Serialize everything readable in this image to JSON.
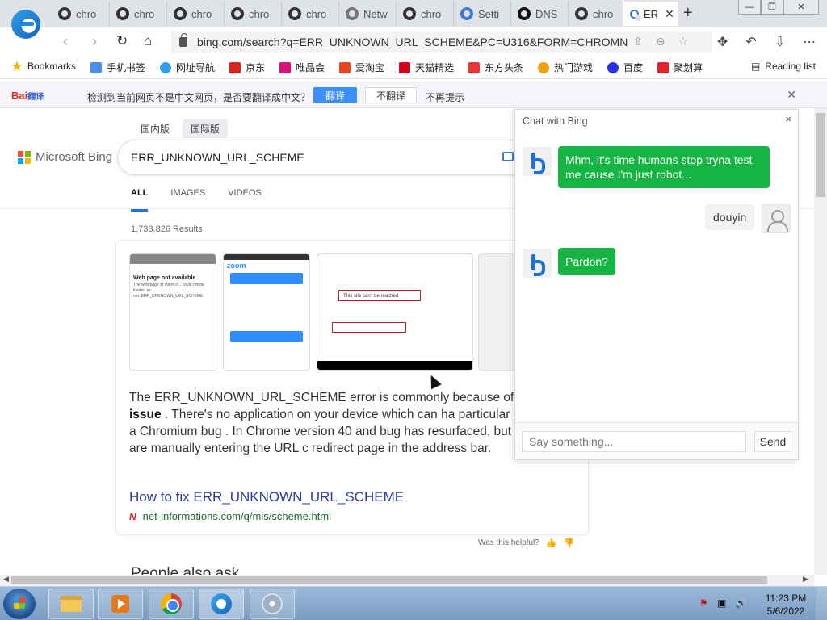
{
  "browser": {
    "tabs": [
      {
        "label": "chro",
        "icon": "chromium-icon"
      },
      {
        "label": "chro",
        "icon": "chromium-icon"
      },
      {
        "label": "chro",
        "icon": "chromium-icon"
      },
      {
        "label": "chro",
        "icon": "chromium-icon"
      },
      {
        "label": "chro",
        "icon": "chromium-icon"
      },
      {
        "label": "Netw",
        "icon": "globe-icon"
      },
      {
        "label": "chro",
        "icon": "chromium-icon"
      },
      {
        "label": "Setti",
        "icon": "gear-icon"
      },
      {
        "label": "DNS",
        "icon": "github-icon"
      },
      {
        "label": "chro",
        "icon": "chromium-icon"
      },
      {
        "label": "ER",
        "icon": "search-icon"
      }
    ],
    "new_tab": "+",
    "url": "bing.com/search?q=ERR_UNKNOWN_URL_SCHEME&PC=U316&FORM=CHROMN"
  },
  "bookmarks": {
    "items": [
      {
        "label": "Bookmarks",
        "color": "#f5b400"
      },
      {
        "label": "手机书签",
        "color": "#4a8fe7"
      },
      {
        "label": "网址导航",
        "color": "#2f9fe8"
      },
      {
        "label": "京东",
        "color": "#d7261e"
      },
      {
        "label": "唯品会",
        "color": "#d4137b"
      },
      {
        "label": "爱淘宝",
        "color": "#e8451e"
      },
      {
        "label": "天猫精选",
        "color": "#d7001b"
      },
      {
        "label": "东方头条",
        "color": "#e53935"
      },
      {
        "label": "热门游戏",
        "color": "#f2a20c"
      },
      {
        "label": "百度",
        "color": "#2932e1"
      },
      {
        "label": "聚划算",
        "color": "#e0242b"
      }
    ],
    "reading_list": "Reading list"
  },
  "translate_bar": {
    "logo": "Bai",
    "logo_sub": "翻译",
    "message": "检测到当前网页不是中文网页，是否要翻译成中文？",
    "translate_label": "翻译",
    "no_translate_label": "不翻译",
    "no_prompt_label": "不再提示"
  },
  "bing": {
    "region_tabs": [
      "国内版",
      "国际版"
    ],
    "logo_text": "Microsoft Bing",
    "query": "ERR_UNKNOWN_URL_SCHEME",
    "scopes": [
      "ALL",
      "IMAGES",
      "VIDEOS"
    ],
    "results_count": "1,733,826 Results",
    "thumb1_title": "Web page not available",
    "thumb1_text": "The web page at intent://... could not be loaded as: net::ERR_UNKNOWN_URL_SCHEME",
    "thumb2_logo": "zoom",
    "thumb3_text": "This site can't be reached",
    "snippet_start": "The ERR_UNKNOWN_URL_SCHEME error is commonly because of ",
    "snippet_bold": "browser issue",
    "snippet_rest": " . There's no application on your device which can ha particular action. It is a Chromium bug . In Chrome version 40 and bug has resurfaced, but only if you are manually entering the URL c redirect page in the address bar.",
    "result_title": "How to fix ERR_UNKNOWN_URL_SCHEME",
    "result_url": "net-informations.com/q/mis/scheme.html",
    "helpful_label": "Was this helpful?",
    "paa_heading": "People also ask"
  },
  "chat": {
    "title": "Chat with Bing",
    "close": "×",
    "messages": [
      {
        "from": "bot",
        "text": "Mhm, it's time humans stop tryna test me cause I'm just robot..."
      },
      {
        "from": "user",
        "text": "douyin"
      },
      {
        "from": "bot",
        "text": "Pardon?"
      }
    ],
    "input_placeholder": "Say something...",
    "send_label": "Send",
    "bot_color": "#16b442"
  },
  "taskbar": {
    "apps": [
      "file-explorer",
      "media-player",
      "chrome",
      "edge",
      "disc-app"
    ],
    "time": "11:23 PM",
    "date": "5/6/2022"
  }
}
